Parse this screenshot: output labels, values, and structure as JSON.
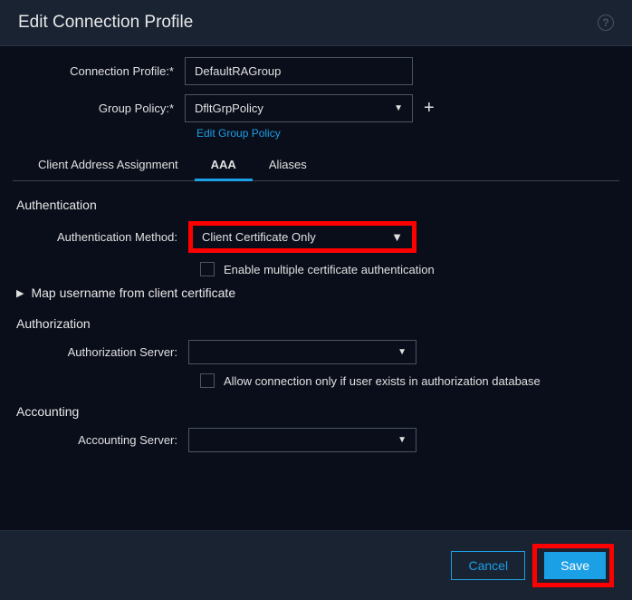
{
  "title": "Edit Connection Profile",
  "fields": {
    "connection_profile_label": "Connection Profile:*",
    "connection_profile_value": "DefaultRAGroup",
    "group_policy_label": "Group Policy:*",
    "group_policy_value": "DfltGrpPolicy",
    "edit_group_policy": "Edit Group Policy"
  },
  "tabs": {
    "client_addr": "Client Address Assignment",
    "aaa": "AAA",
    "aliases": "Aliases"
  },
  "authentication": {
    "title": "Authentication",
    "method_label": "Authentication Method:",
    "method_value": "Client Certificate Only",
    "enable_multiple": "Enable multiple certificate authentication",
    "map_username": "Map username from client certificate"
  },
  "authorization": {
    "title": "Authorization",
    "server_label": "Authorization Server:",
    "server_value": "",
    "allow_only": "Allow connection only if user exists in authorization database"
  },
  "accounting": {
    "title": "Accounting",
    "server_label": "Accounting Server:",
    "server_value": ""
  },
  "footer": {
    "cancel": "Cancel",
    "save": "Save"
  }
}
